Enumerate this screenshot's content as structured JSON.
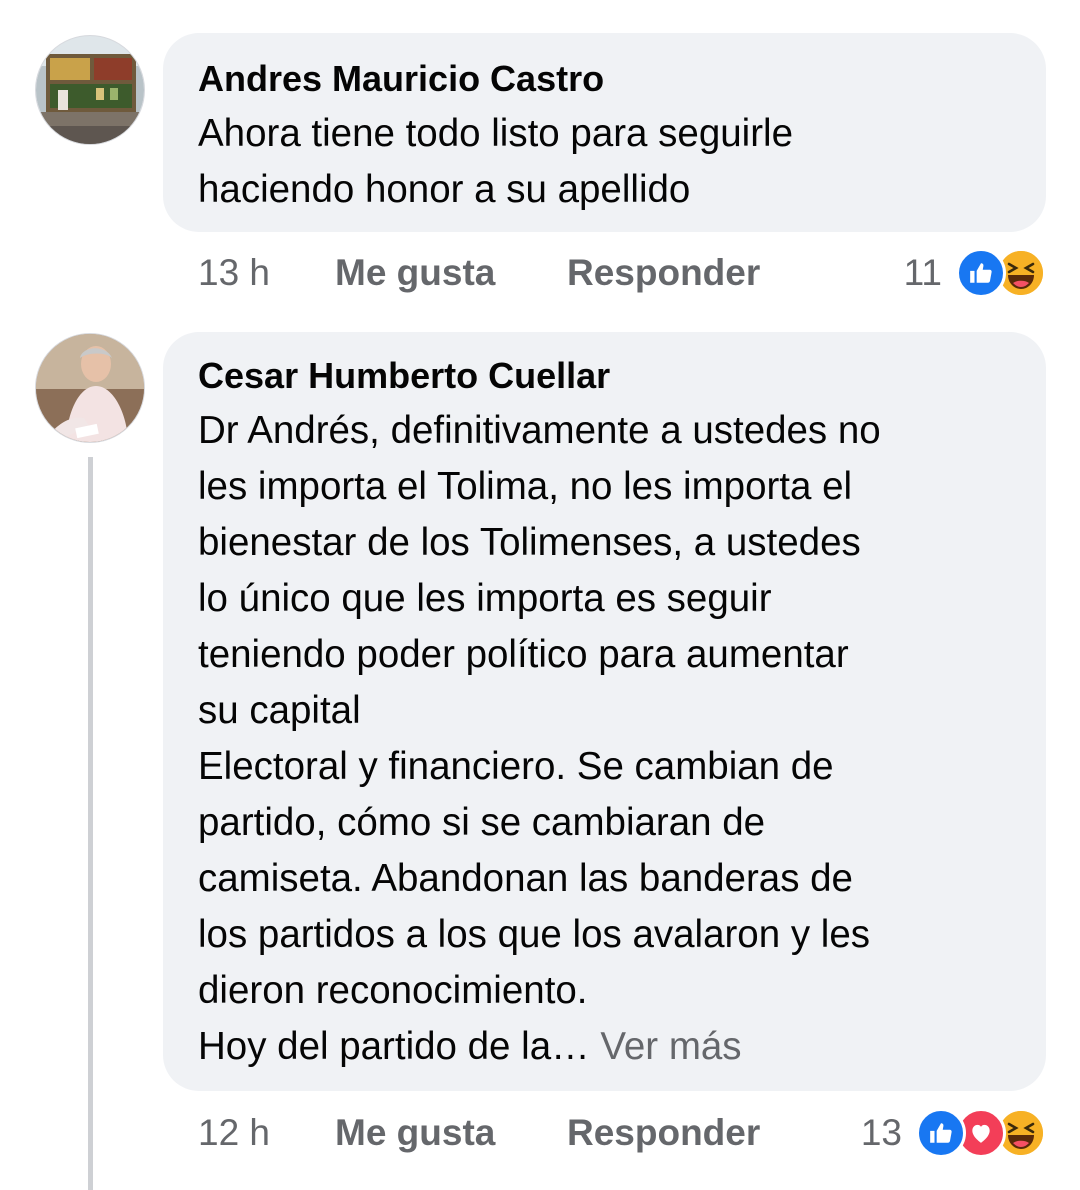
{
  "comments": [
    {
      "author": "Andres Mauricio Castro",
      "text_lines": [
        "Ahora tiene todo listo para seguirle",
        "haciendo honor a su apellido"
      ],
      "time": "13 h",
      "like_label": "Me gusta",
      "reply_label": "Responder",
      "reaction_count": "11",
      "reactions": [
        "like-icon",
        "haha-icon"
      ]
    },
    {
      "author": "Cesar Humberto Cuellar",
      "text_lines": [
        "Dr Andrés, definitivamente a ustedes no",
        "les importa el Tolima, no les importa el",
        "bienestar de los Tolimenses, a ustedes",
        "lo único que les importa es seguir",
        "teniendo poder político para aumentar",
        "su capital",
        "Electoral y financiero. Se cambian de",
        "partido, cómo si se cambiaran de",
        "camiseta. Abandonan las banderas de",
        "los partidos a los que los avalaron y les",
        "dieron reconocimiento."
      ],
      "last_line": "Hoy del partido de la…",
      "see_more": "Ver más",
      "time": "12 h",
      "like_label": "Me gusta",
      "reply_label": "Responder",
      "reaction_count": "13",
      "reactions": [
        "like-icon",
        "love-icon",
        "haha-icon"
      ]
    }
  ],
  "colors": {
    "bubble": "#f0f2f5",
    "secondary_text": "#65676b",
    "like": "#1877f2",
    "love": "#f33e58",
    "haha": "#f7b125"
  }
}
